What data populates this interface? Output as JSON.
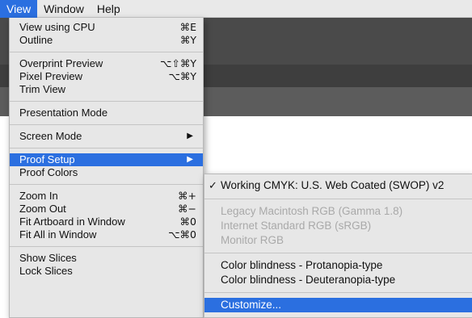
{
  "menubar": {
    "items": [
      {
        "label": "View",
        "active": true
      },
      {
        "label": "Window",
        "active": false
      },
      {
        "label": "Help",
        "active": false
      }
    ]
  },
  "view_menu": {
    "groups": [
      [
        {
          "label": "View using CPU",
          "shortcut": "⌘E"
        },
        {
          "label": "Outline",
          "shortcut": "⌘Y"
        }
      ],
      [
        {
          "label": "Overprint Preview",
          "shortcut": "⌥⇧⌘Y"
        },
        {
          "label": "Pixel Preview",
          "shortcut": "⌥⌘Y"
        },
        {
          "label": "Trim View",
          "shortcut": ""
        }
      ],
      [
        {
          "label": "Presentation Mode",
          "shortcut": ""
        }
      ],
      [
        {
          "label": "Screen Mode",
          "shortcut": "",
          "submenu": true
        }
      ],
      [
        {
          "label": "Proof Setup",
          "shortcut": "",
          "submenu": true,
          "highlighted": true
        },
        {
          "label": "Proof Colors",
          "shortcut": ""
        }
      ],
      [
        {
          "label": "Zoom In",
          "shortcut": "⌘+"
        },
        {
          "label": "Zoom Out",
          "shortcut": "⌘−"
        },
        {
          "label": "Fit Artboard in Window",
          "shortcut": "⌘0"
        },
        {
          "label": "Fit All in Window",
          "shortcut": "⌥⌘0"
        }
      ],
      [
        {
          "label": "Show Slices",
          "shortcut": ""
        },
        {
          "label": "Lock Slices",
          "shortcut": ""
        }
      ]
    ],
    "submenu_arrow": "▶"
  },
  "proof_submenu": {
    "check_glyph": "✓",
    "working_cmyk": "Working CMYK: U.S. Web Coated (SWOP) v2",
    "legacy_mac": "Legacy Macintosh RGB (Gamma 1.8)",
    "internet_std": "Internet Standard RGB (sRGB)",
    "monitor_rgb": "Monitor RGB",
    "protanopia": "Color blindness - Protanopia-type",
    "deuteranopia": "Color blindness - Deuteranopia-type",
    "customize": "Customize..."
  },
  "colors": {
    "highlight": "#2b6fe0",
    "menu_bg": "#e7e7e7",
    "disabled_text": "#a9a9a9"
  }
}
